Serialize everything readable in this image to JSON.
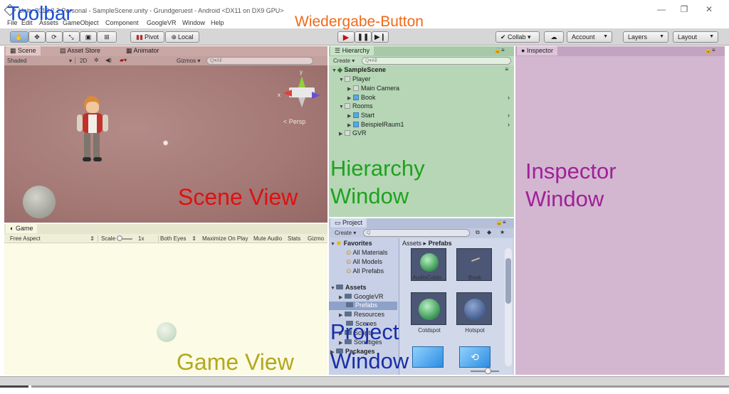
{
  "window": {
    "title": "Unity 2018.2.2 Personal - SampleScene.unity - Grundgeruest - Android <DX11 on DX9 GPU>",
    "minimize_glyph": "—",
    "maximize_glyph": "❐",
    "close_glyph": "✕"
  },
  "menu": {
    "items": [
      "File",
      "Edit",
      "Assets",
      "GameObject",
      "Component",
      "GoogleVR",
      "Window",
      "Help"
    ]
  },
  "toolbar": {
    "pivot_label": "Pivot",
    "local_label": "Local",
    "collab_label": "Collab ▾",
    "account_label": "Account",
    "layers_label": "Layers",
    "layout_label": "Layout"
  },
  "scene": {
    "tabs": [
      "Scene",
      "Asset Store",
      "Animator"
    ],
    "shading": "Shaded",
    "mode2d": "2D",
    "gizmos": "Gizmos",
    "search_placeholder": "Q▾All",
    "persp": "< Persp",
    "axis_x": "x",
    "axis_y": "y"
  },
  "game": {
    "tab": "Game",
    "aspect": "Free Aspect",
    "scale_label": "Scale",
    "scale_value": "1x",
    "both_eyes": "Both Eyes",
    "maximize": "Maximize On Play",
    "mute": "Mute Audio",
    "stats": "Stats",
    "gizmos": "Gizmo"
  },
  "hierarchy": {
    "tab": "Hierarchy",
    "create": "Create ▾",
    "search_placeholder": "Q▾All",
    "scene_name": "SampleScene",
    "rows": [
      {
        "label": "Player"
      },
      {
        "label": "Main Camera"
      },
      {
        "label": "Book"
      },
      {
        "label": "Rooms"
      },
      {
        "label": "Start"
      },
      {
        "label": "BeispielRaum1"
      },
      {
        "label": "GVR"
      }
    ]
  },
  "inspector": {
    "tab": "Inspector"
  },
  "project": {
    "tab": "Project",
    "create": "Create ▾",
    "favorites": "Favorites",
    "fav_items": [
      "All Materials",
      "All Models",
      "All Prefabs"
    ],
    "assets": "Assets",
    "asset_folders": [
      "GoogleVR",
      "Prefabs",
      "Resources",
      "Scenes",
      "Scripts",
      "Sonstiges"
    ],
    "packages": "Packages",
    "breadcrumb_root": "Assets",
    "breadcrumb_sep": "▸",
    "breadcrumb_current": "Prefabs",
    "asset_items": [
      "AudioColds...",
      "Book",
      "Coldspot",
      "Hotspot"
    ]
  },
  "annotations": {
    "toolbar": "Toolbar",
    "playback": "Wiedergabe-Button",
    "scene_l1": "Scene View",
    "hierarchy_l1": "Hierarchy",
    "hierarchy_l2": "Window",
    "inspector_l1": "Inspector",
    "inspector_l2": "Window",
    "project_l1": "Project",
    "project_l2": "Window",
    "game_l1": "Game View"
  },
  "colors": {
    "toolbar_label": "#1a4fd6",
    "playback_label": "#f06a1a",
    "scene_label": "#e01010",
    "hierarchy_label": "#1ea21e",
    "inspector_label": "#a0209a",
    "project_label": "#1a2ea8",
    "game_label": "#b3a81e",
    "scene_bg": "#a57b79",
    "hierarchy_bg": "#b6d6b6",
    "inspector_bg": "#d3b7d0",
    "project_bg": "#c7d0e6",
    "game_bg": "#fbfbe6"
  }
}
